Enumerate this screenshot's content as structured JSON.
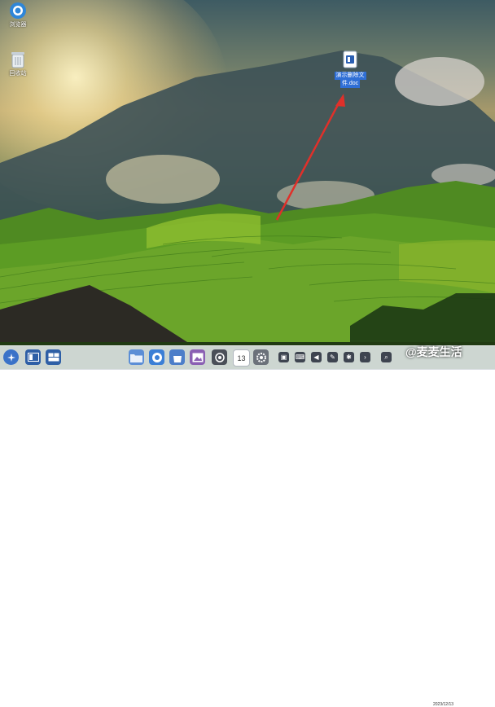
{
  "desktop": {
    "icons": [
      {
        "label": "浏览器",
        "icon": "browser-icon"
      },
      {
        "label": "回收站",
        "icon": "trash-icon"
      },
      {
        "label_line1": "演示删除文",
        "label_line2": "件.doc",
        "icon": "document-icon"
      }
    ]
  },
  "taskbar": {
    "calendar_day": "13",
    "date": "2023/12/13",
    "watermark": "@麦麦生活"
  },
  "colors": {
    "selection": "#2f6fd6",
    "arrow": "#e0302a",
    "taskbar": "#d6dae0"
  }
}
